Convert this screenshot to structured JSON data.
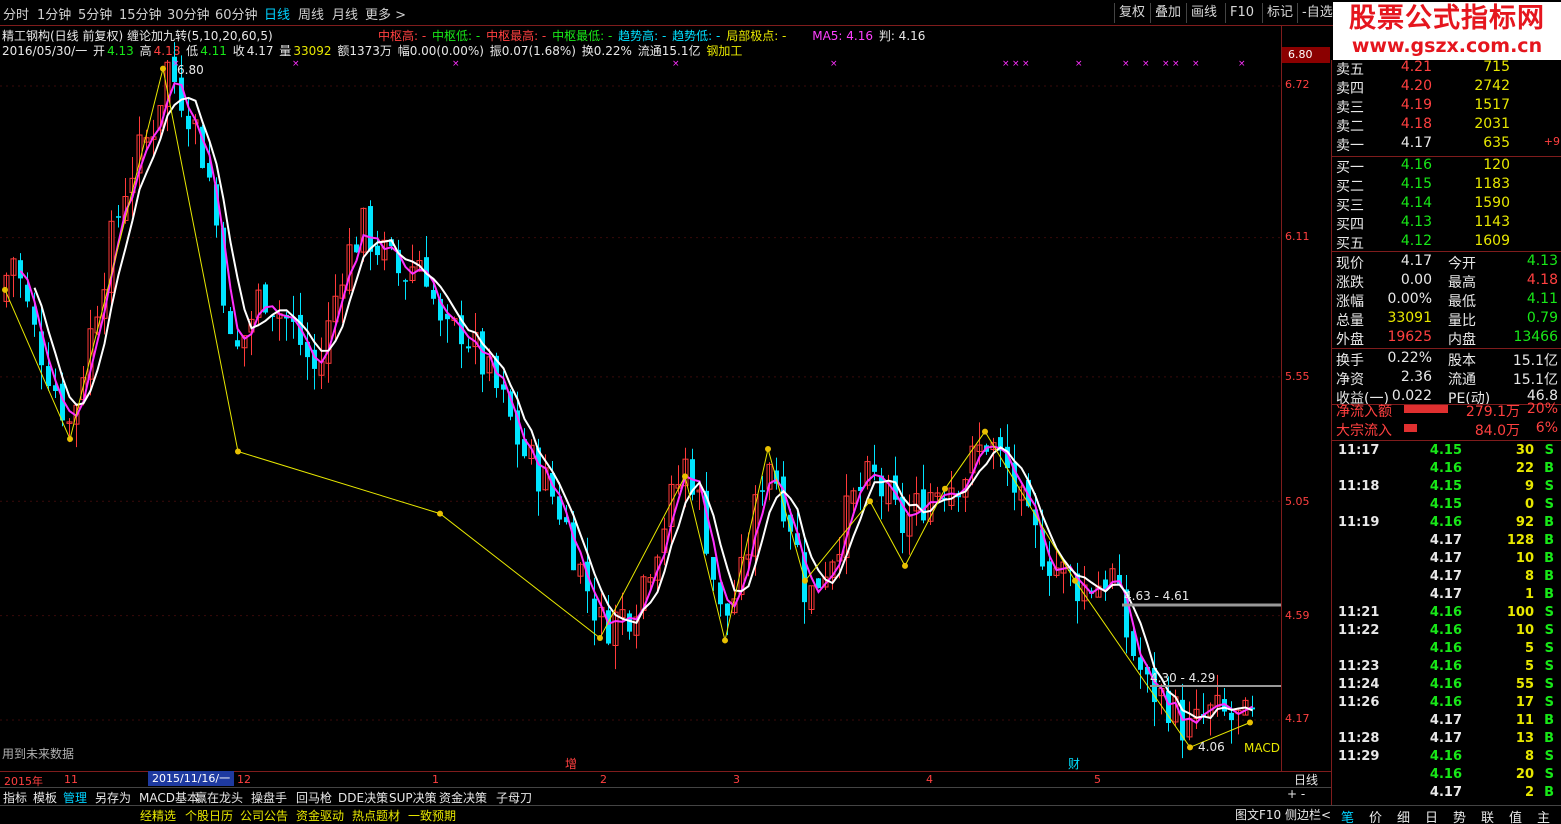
{
  "periods": [
    "分时",
    "1分钟",
    "5分钟",
    "15分钟",
    "30分钟",
    "60分钟",
    "日线",
    "周线",
    "月线",
    "更多 >"
  ],
  "active_period": "日线",
  "toolbar": {
    "fuquan": "复权",
    "diejia": "叠加",
    "huaxian": "画线",
    "f10": "F10",
    "biaoji": "标记",
    "zixuan": "-自选"
  },
  "logo": {
    "line1": "股票公式指标网",
    "line2": "www.gszx.com.cn"
  },
  "info1": {
    "title": "精工钢构(日线 前复权) 缠论加九转(5,10,20,60,5)",
    "zs_high": "中枢高: -",
    "zs_low": "中枢低: -",
    "zs_max": "中枢最高: -",
    "zs_min": "中枢最低: -",
    "trend_high": "趋势高: -",
    "trend_low": "趋势低: -",
    "local": "局部极点: -",
    "ma5": "MA5: 4.16",
    "judge": "判: 4.16"
  },
  "info2": {
    "date": "2016/05/30/一",
    "open_label": "开",
    "open": "4.13",
    "high_label": "高",
    "high": "4.18",
    "low_label": "低",
    "low": "4.11",
    "close_label": "收",
    "close": "4.17",
    "vol_label": "量",
    "vol": "33092",
    "amount": "额1373万",
    "fu": "幅0.00(0.00%)",
    "zhen": "振0.07(1.68%)",
    "huan": "换0.22%",
    "flow": "流通15.1亿",
    "industry": "钢加工"
  },
  "y_ticks": [
    "6.72",
    "6.11",
    "5.55",
    "5.05",
    "4.59",
    "4.17"
  ],
  "price_tag": "6.80",
  "x_labels": [
    "2015年",
    "11",
    "12",
    "1",
    "2",
    "3",
    "4",
    "5"
  ],
  "x_selected": "2015/11/16/一",
  "x_markers": {
    "zeng": "增",
    "cai": "财"
  },
  "chart_notes": {
    "high_label": "6.80",
    "low_label": "4.06",
    "zone1": "4.63 - 4.61",
    "zone2": "4.30 - 4.29",
    "future": "用到未来数据",
    "macd": "MACD"
  },
  "bottom_tabs": [
    "指标",
    "模板",
    "管理",
    "另存为",
    "MACD基本",
    "赢在龙头",
    "操盘手",
    "回马枪",
    "DDE决策",
    "SUP决策",
    "资金决策",
    "子母刀"
  ],
  "active_tab": "管理",
  "links": [
    "个股日历",
    "公司公告",
    "资金驱动",
    "热点题材",
    "一致预期"
  ],
  "link_prefix": "经精选",
  "fn_bar": "图文F10  侧边栏<",
  "day_label": "日线",
  "zoom": "+ -",
  "order_book": {
    "sells": [
      {
        "label": "卖五",
        "price": "4.21",
        "vol": "715"
      },
      {
        "label": "卖四",
        "price": "4.20",
        "vol": "2742"
      },
      {
        "label": "卖三",
        "price": "4.19",
        "vol": "1517"
      },
      {
        "label": "卖二",
        "price": "4.18",
        "vol": "2031"
      },
      {
        "label": "卖一",
        "price": "4.17",
        "vol": "635",
        "chg": "+9"
      }
    ],
    "buys": [
      {
        "label": "买一",
        "price": "4.16",
        "vol": "120"
      },
      {
        "label": "买二",
        "price": "4.15",
        "vol": "1183"
      },
      {
        "label": "买三",
        "price": "4.14",
        "vol": "1590"
      },
      {
        "label": "买四",
        "price": "4.13",
        "vol": "1143"
      },
      {
        "label": "买五",
        "price": "4.12",
        "vol": "1609"
      }
    ]
  },
  "fundamentals": [
    {
      "l1": "现价",
      "a": "4.17",
      "ac": "#e8e8e8",
      "l2": "今开",
      "b": "4.13",
      "bc": "#18e818"
    },
    {
      "l1": "涨跌",
      "a": "0.00",
      "ac": "#e8e8e8",
      "l2": "最高",
      "b": "4.18",
      "bc": "#ff4040"
    },
    {
      "l1": "涨幅",
      "a": "0.00%",
      "ac": "#e8e8e8",
      "l2": "最低",
      "b": "4.11",
      "bc": "#18e818"
    },
    {
      "l1": "总量",
      "a": "33091",
      "ac": "#e8e800",
      "l2": "量比",
      "b": "0.79",
      "bc": "#18e818"
    },
    {
      "l1": "外盘",
      "a": "19625",
      "ac": "#ff4040",
      "l2": "内盘",
      "b": "13466",
      "bc": "#18e818"
    },
    {
      "l1": "换手",
      "a": "0.22%",
      "ac": "#e8e8e8",
      "l2": "股本",
      "b": "15.1亿",
      "bc": "#e8e8e8"
    },
    {
      "l1": "净资",
      "a": "2.36",
      "ac": "#e8e8e8",
      "l2": "流通",
      "b": "15.1亿",
      "bc": "#e8e8e8"
    },
    {
      "l1": "收益(一)",
      "a": "0.022",
      "ac": "#e8e8e8",
      "l2": "PE(动)",
      "b": "46.8",
      "bc": "#e8e8e8"
    }
  ],
  "flows": [
    {
      "label": "净流入额",
      "value": "279.1万",
      "pct": "20%",
      "ratio": 0.2
    },
    {
      "label": "大宗流入",
      "value": "84.0万",
      "pct": "6%",
      "ratio": 0.06
    }
  ],
  "ticks": [
    {
      "t": "11:17",
      "p": "4.15",
      "pc": "#18e818",
      "v": "30",
      "s": "S"
    },
    {
      "t": "",
      "p": "4.16",
      "pc": "#18e818",
      "v": "22",
      "s": "B"
    },
    {
      "t": "11:18",
      "p": "4.15",
      "pc": "#18e818",
      "v": "9",
      "s": "S"
    },
    {
      "t": "",
      "p": "4.15",
      "pc": "#18e818",
      "v": "0",
      "s": "S"
    },
    {
      "t": "11:19",
      "p": "4.16",
      "pc": "#18e818",
      "v": "92",
      "s": "B"
    },
    {
      "t": "",
      "p": "4.17",
      "pc": "#e8e8e8",
      "v": "128",
      "s": "B"
    },
    {
      "t": "",
      "p": "4.17",
      "pc": "#e8e8e8",
      "v": "10",
      "s": "B"
    },
    {
      "t": "",
      "p": "4.17",
      "pc": "#e8e8e8",
      "v": "8",
      "s": "B"
    },
    {
      "t": "",
      "p": "4.17",
      "pc": "#e8e8e8",
      "v": "1",
      "s": "B"
    },
    {
      "t": "11:21",
      "p": "4.16",
      "pc": "#18e818",
      "v": "100",
      "s": "S"
    },
    {
      "t": "11:22",
      "p": "4.16",
      "pc": "#18e818",
      "v": "10",
      "s": "S"
    },
    {
      "t": "",
      "p": "4.16",
      "pc": "#18e818",
      "v": "5",
      "s": "S"
    },
    {
      "t": "11:23",
      "p": "4.16",
      "pc": "#18e818",
      "v": "5",
      "s": "S"
    },
    {
      "t": "11:24",
      "p": "4.16",
      "pc": "#18e818",
      "v": "55",
      "s": "S"
    },
    {
      "t": "11:26",
      "p": "4.16",
      "pc": "#18e818",
      "v": "17",
      "s": "S"
    },
    {
      "t": "",
      "p": "4.17",
      "pc": "#e8e8e8",
      "v": "11",
      "s": "B"
    },
    {
      "t": "11:28",
      "p": "4.17",
      "pc": "#e8e8e8",
      "v": "13",
      "s": "B"
    },
    {
      "t": "11:29",
      "p": "4.16",
      "pc": "#18e818",
      "v": "8",
      "s": "S"
    },
    {
      "t": "",
      "p": "4.16",
      "pc": "#18e818",
      "v": "20",
      "s": "S"
    },
    {
      "t": "",
      "p": "4.17",
      "pc": "#e8e8e8",
      "v": "2",
      "s": "B"
    }
  ],
  "panel_tabs": [
    "笔",
    "价",
    "细",
    "日",
    "势",
    "联",
    "值",
    "主"
  ],
  "colors": {
    "up": "#ff3a3a",
    "down": "#00e5ff",
    "ma_white": "#ffffff",
    "ma_magenta": "#ff30ff",
    "zigzag": "#e8e800",
    "bg": "#000000"
  }
}
